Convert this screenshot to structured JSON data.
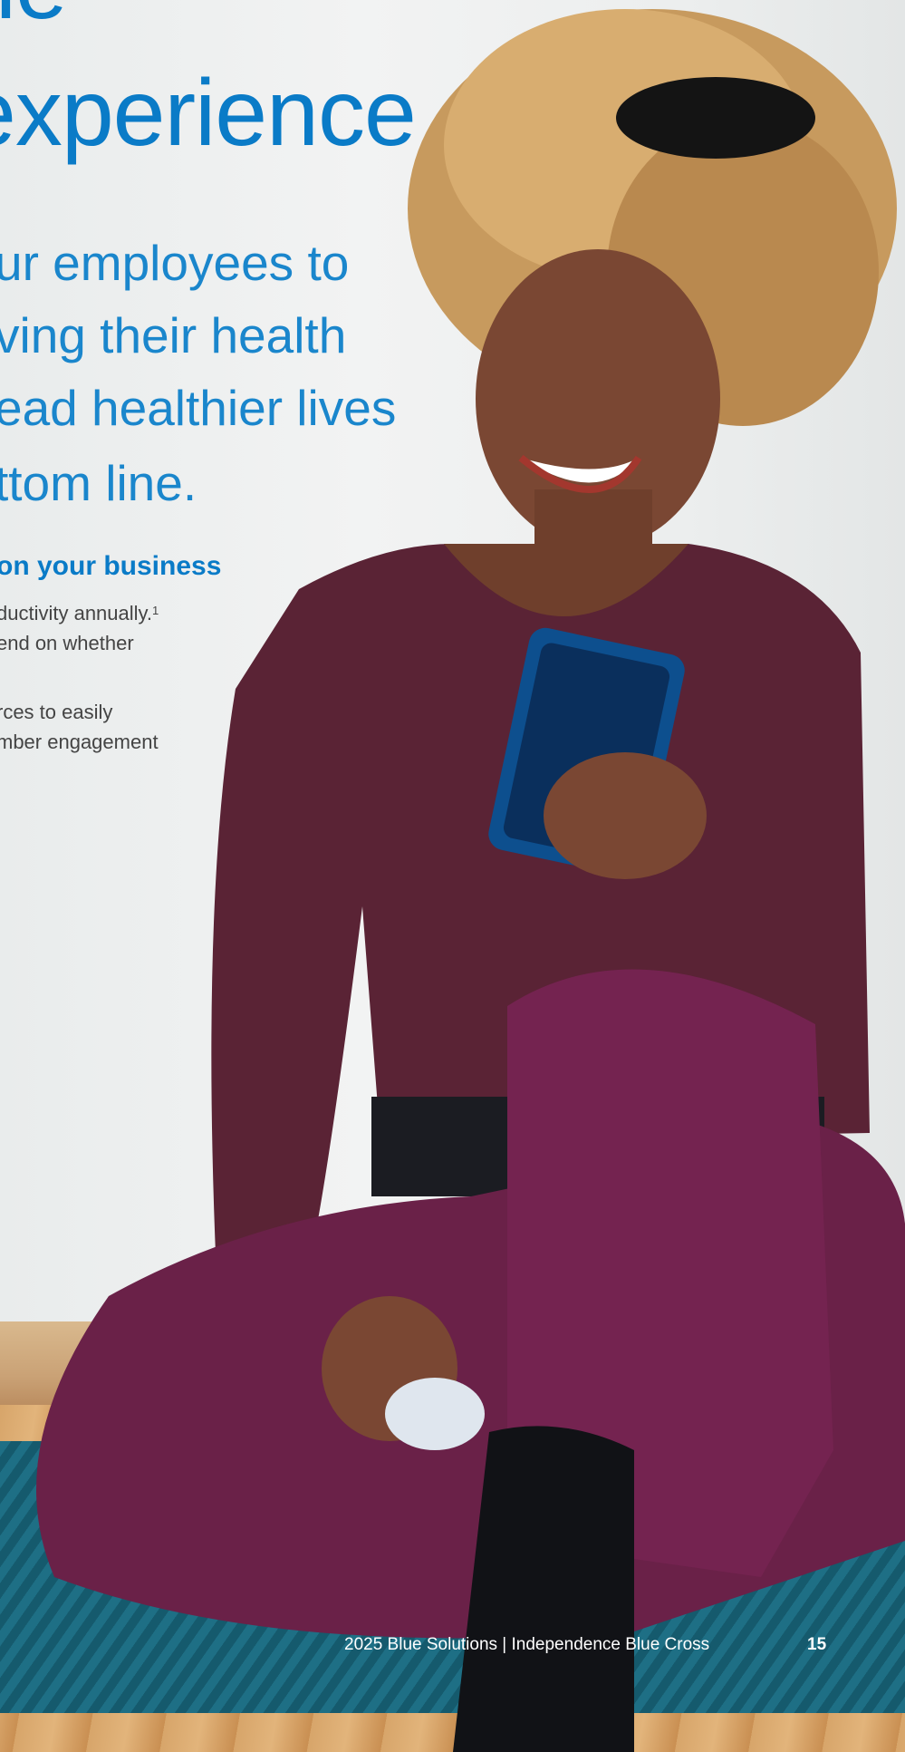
{
  "headline": {
    "line1": "he",
    "line2": "experience"
  },
  "subheadline": {
    "line1": "ur employees to",
    "line2": "ving their health",
    "line3": "ead healthier lives",
    "line4": "ttom line."
  },
  "section": {
    "title": "on your business",
    "lines": [
      "ductivity annually.",
      "end on whether",
      "rces to easily",
      "mber engagement"
    ],
    "footnote": "1"
  },
  "footer": {
    "text": "2025 Blue Solutions  |  Independence Blue Cross",
    "page_number": "15"
  },
  "colors": {
    "brand_blue": "#0a7bc7",
    "body_text": "#444444",
    "footer_text": "#ffffff"
  }
}
